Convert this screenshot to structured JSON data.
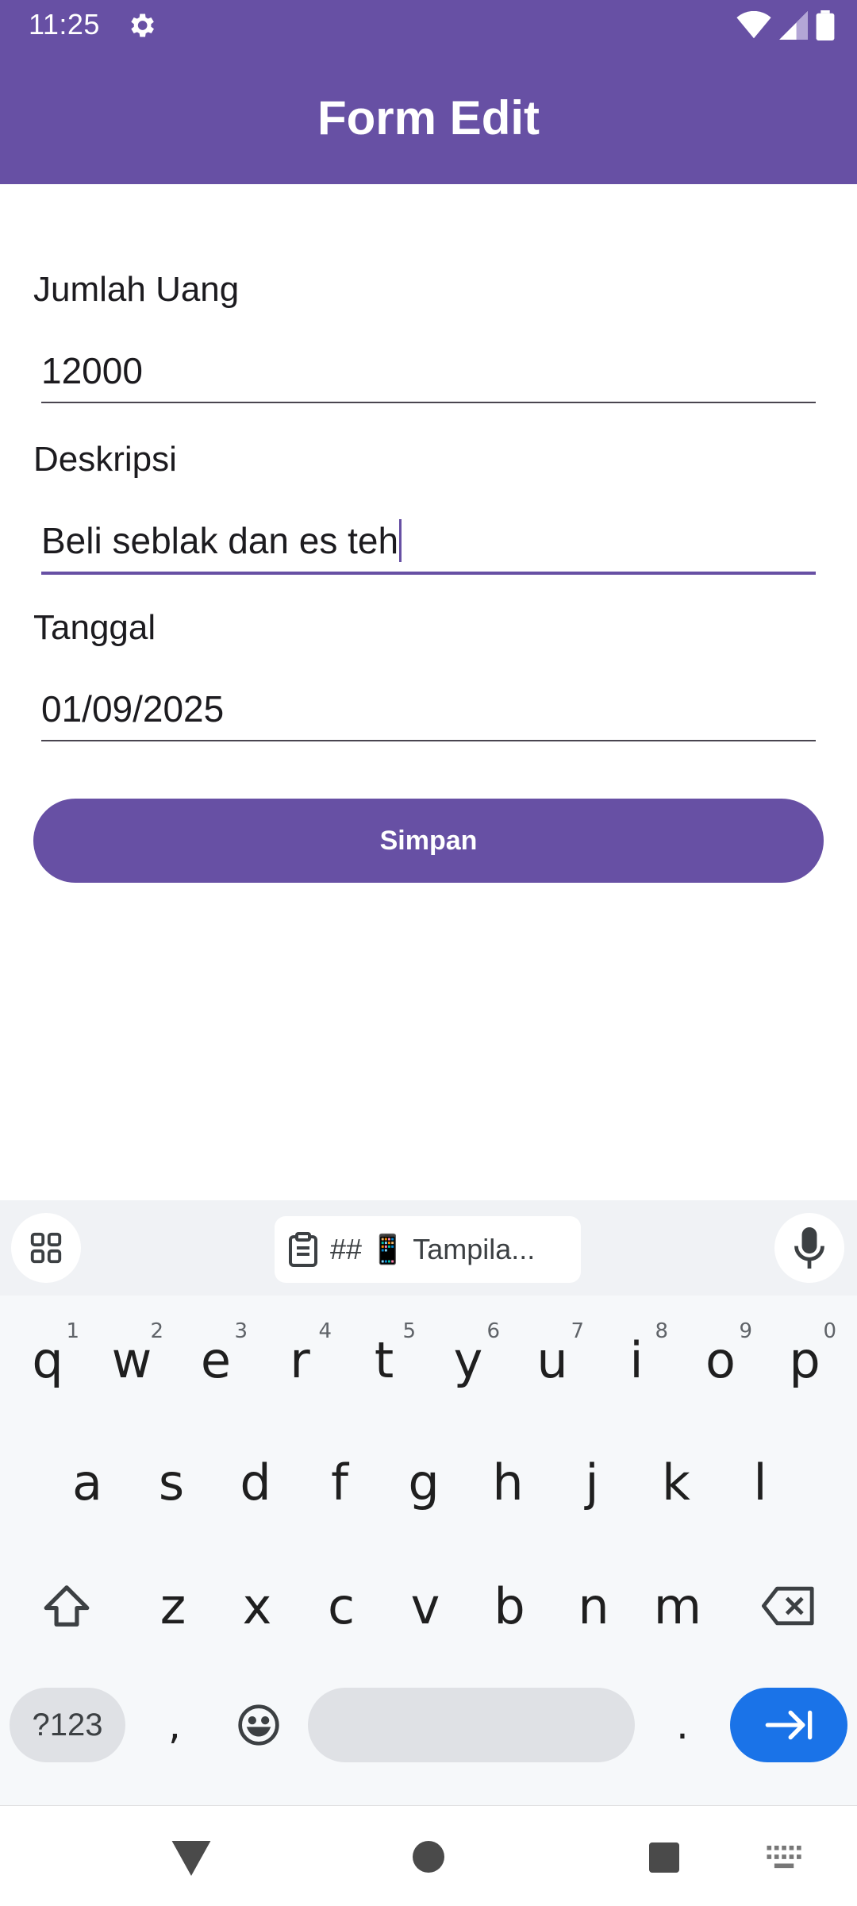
{
  "status_bar": {
    "time": "11:25"
  },
  "app_bar": {
    "title": "Form Edit"
  },
  "form": {
    "amount_label": "Jumlah Uang",
    "amount_value": "12000",
    "description_label": "Deskripsi",
    "description_value": "Beli seblak dan es teh",
    "date_label": "Tanggal",
    "date_value": "01/09/2025",
    "save_label": "Simpan"
  },
  "keyboard": {
    "clipboard_chip": "## 📱 Tampila...",
    "row1": [
      "q",
      "w",
      "e",
      "r",
      "t",
      "y",
      "u",
      "i",
      "o",
      "p"
    ],
    "row1_numbers": [
      "1",
      "2",
      "3",
      "4",
      "5",
      "6",
      "7",
      "8",
      "9",
      "0"
    ],
    "row2": [
      "a",
      "s",
      "d",
      "f",
      "g",
      "h",
      "j",
      "k",
      "l"
    ],
    "row3": [
      "z",
      "x",
      "c",
      "v",
      "b",
      "n",
      "m"
    ],
    "symbols_label": "?123",
    "comma": ",",
    "period": "."
  },
  "colors": {
    "primary": "#6750a4",
    "accent_blue": "#1a73e8"
  }
}
